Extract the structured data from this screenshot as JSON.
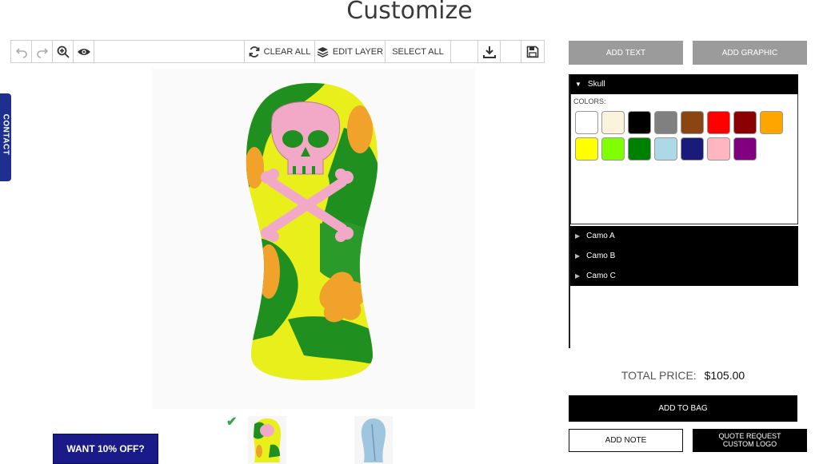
{
  "page": {
    "title": "Customize"
  },
  "toolbar": {
    "undo_icon": "undo-icon",
    "redo_icon": "redo-icon",
    "zoom_icon": "zoom-in-icon",
    "preview_icon": "eye-icon",
    "clear_all_label": "CLEAR ALL",
    "edit_layer_label": "EDIT LAYER",
    "select_all_label": "SELECT ALL",
    "download_icon": "download-icon",
    "save_icon": "save-icon"
  },
  "contact_tab": {
    "label": "CONTACT"
  },
  "promo": {
    "label": "WANT 10% OFF?"
  },
  "right_panel": {
    "add_text_label": "ADD TEXT",
    "add_graphic_label": "ADD GRAPHIC",
    "layers": [
      {
        "name": "Skull",
        "expanded": true
      },
      {
        "name": "Camo A",
        "expanded": false
      },
      {
        "name": "Camo B",
        "expanded": false
      },
      {
        "name": "Camo C",
        "expanded": false
      }
    ],
    "colors_label": "COLORS:",
    "colors": [
      "#ffffff",
      "#fbf3dc",
      "#000000",
      "#808080",
      "#8b4513",
      "#ff0000",
      "#8b0000",
      "#ffa500",
      "#ffff00",
      "#7fff00",
      "#008000",
      "#add8e6",
      "#1a1a7a",
      "#ffb6c1",
      "#800080"
    ],
    "total_price_label": "TOTAL PRICE:",
    "total_price_value": "$105.00",
    "add_to_bag_label": "ADD TO BAG",
    "add_note_label": "ADD NOTE",
    "quote_line1": "QUOTE REQUEST",
    "quote_line2": "CUSTOM LOGO"
  },
  "thumbnails": {
    "selected_icon": "checkmark-icon"
  }
}
